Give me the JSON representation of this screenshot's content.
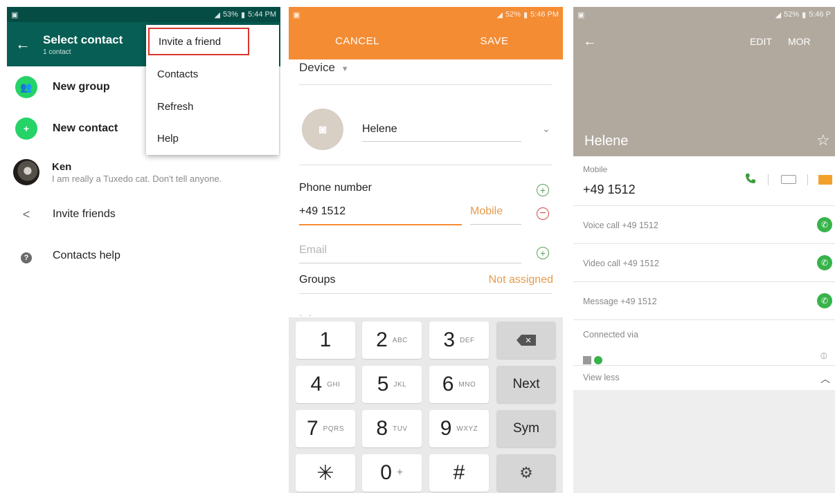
{
  "panel1": {
    "status": {
      "time": "5:44 PM",
      "battery": "53%"
    },
    "appbar": {
      "back_icon": "←",
      "title": "Select contact",
      "subtitle": "1 contact"
    },
    "list": [
      {
        "label": "New group",
        "icon": "group-icon"
      },
      {
        "label": "New contact",
        "icon": "add-contact-icon"
      }
    ],
    "contact": {
      "name": "Ken",
      "status": "I am really a Tuxedo cat. Don't tell anyone."
    },
    "invite_label": "Invite friends",
    "help_label": "Contacts help",
    "menu": {
      "items": [
        "Invite a friend",
        "Contacts",
        "Refresh",
        "Help"
      ]
    }
  },
  "panel2": {
    "status": {
      "time": "5:46 PM",
      "battery": "52%"
    },
    "cancel_label": "CANCEL",
    "save_label": "SAVE",
    "account_label": "Device",
    "name_value": "Helene",
    "phone_label": "Phone number",
    "phone_value": "+49 1512",
    "phone_type": "Mobile",
    "email_placeholder": "Email",
    "groups_label": "Groups",
    "groups_value": "Not assigned",
    "keys": [
      {
        "main": "1",
        "sub": ""
      },
      {
        "main": "2",
        "sub": "ABC"
      },
      {
        "main": "3",
        "sub": "DEF"
      },
      {
        "main": "4",
        "sub": "GHI"
      },
      {
        "main": "5",
        "sub": "JKL"
      },
      {
        "main": "6",
        "sub": "MNO"
      },
      {
        "main": "7",
        "sub": "PQRS"
      },
      {
        "main": "8",
        "sub": "TUV"
      },
      {
        "main": "9",
        "sub": "WXYZ"
      },
      {
        "main": "✳",
        "sub": ""
      },
      {
        "main": "0",
        "sub": "+"
      },
      {
        "main": "#",
        "sub": ""
      }
    ],
    "next_label": "Next",
    "sym_label": "Sym"
  },
  "panel3": {
    "status": {
      "time": "5:46 P",
      "battery": "52%"
    },
    "edit_label": "EDIT",
    "more_label": "MOR",
    "contact_name": "Helene",
    "mobile_label": "Mobile",
    "mobile_value": "+49 1512",
    "voice_call": "Voice call +49 1512",
    "video_call": "Video call +49 1512",
    "message": "Message +49 1512",
    "connected_label": "Connected via",
    "view_less": "View less"
  },
  "colors": {
    "whatsapp_dark": "#075e54",
    "whatsapp_green": "#25d366",
    "samsung_orange": "#f48c34",
    "contact_header": "#b1a99e",
    "highlight_red": "#d9362b"
  }
}
